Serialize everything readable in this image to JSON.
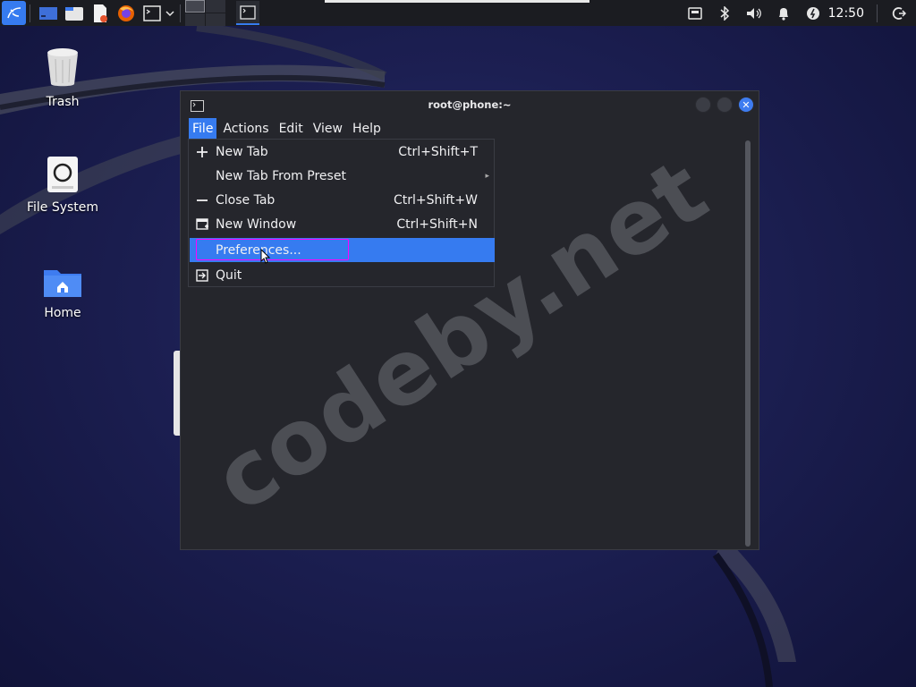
{
  "taskbar": {
    "clock": "12:50",
    "icons": [
      "kali-menu-icon",
      "desktop-icon",
      "file-manager-icon",
      "text-editor-icon",
      "firefox-icon",
      "terminal-icon",
      "chevron-down-icon"
    ]
  },
  "desktop": {
    "trash_label": "Trash",
    "filesystem_label": "File System",
    "home_label": "Home"
  },
  "window": {
    "title": "root@phone:~",
    "close_glyph": "✕"
  },
  "menubar": {
    "file": "File",
    "actions": "Actions",
    "edit": "Edit",
    "view": "View",
    "help": "Help"
  },
  "file_menu": {
    "items": [
      {
        "label": "New Tab",
        "shortcut": "Ctrl+Shift+T",
        "icon": "plus-icon"
      },
      {
        "label": "New Tab From Preset",
        "shortcut": "",
        "icon": "",
        "submenu": "▸"
      },
      {
        "label": "Close Tab",
        "shortcut": "Ctrl+Shift+W",
        "icon": "minus-icon"
      },
      {
        "label": "New Window",
        "shortcut": "Ctrl+Shift+N",
        "icon": "new-window-icon"
      },
      {
        "label": "Preferences...",
        "shortcut": "",
        "icon": "",
        "highlighted": true
      },
      {
        "label": "Quit",
        "shortcut": "",
        "icon": "quit-icon"
      }
    ]
  },
  "watermark": "codeby.net",
  "colors": {
    "accent": "#367bf0",
    "highlight_outline": "#ff00ff",
    "window_bg": "#25262c",
    "taskbar_bg": "#1b1c21"
  }
}
